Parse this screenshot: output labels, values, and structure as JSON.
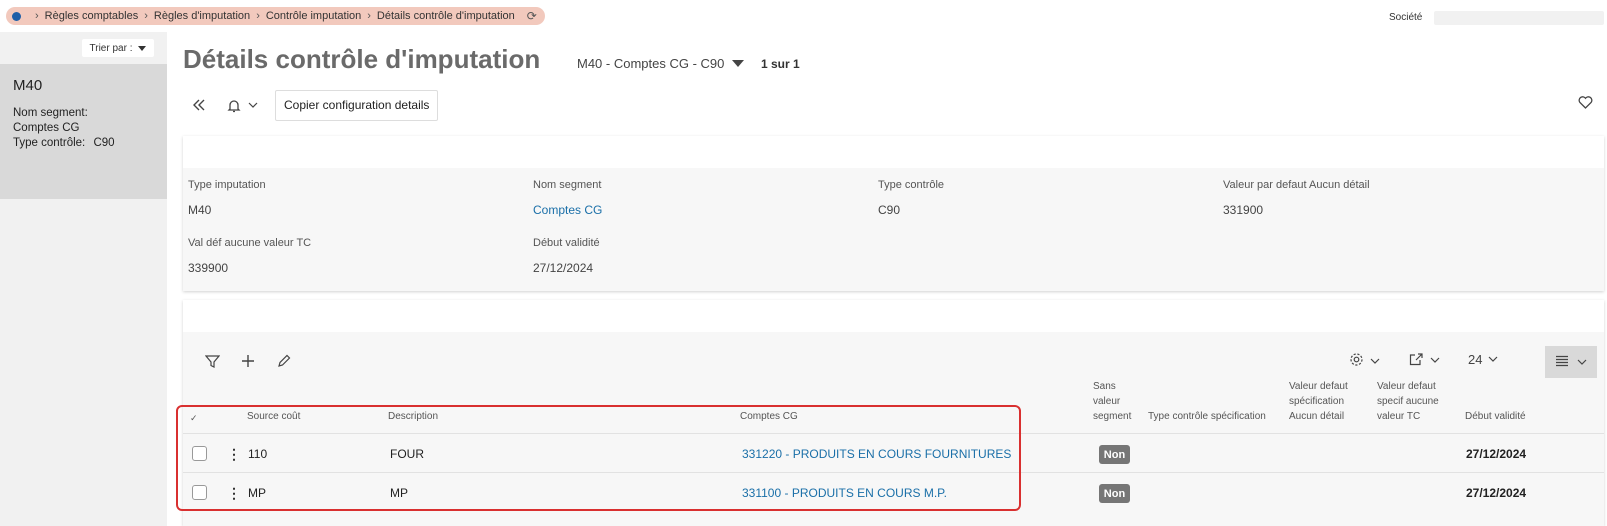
{
  "breadcrumb": [
    "Règles comptables",
    "Règles d'imputation",
    "Contrôle imputation",
    "Détails contrôle d'imputation"
  ],
  "societe_label": "Société",
  "sidebar": {
    "sort_label": "Trier par :",
    "card": {
      "title": "M40",
      "line1": "Nom segment:",
      "line2": "Comptes CG",
      "line3_label": "Type contrôle:",
      "line3_value": "C90"
    }
  },
  "header": {
    "title": "Détails contrôle d'imputation",
    "selector": "M40 - Comptes CG - C90",
    "pager": "1 sur 1"
  },
  "toolbar": {
    "copy_label": "Copier configuration details"
  },
  "details": {
    "type_imputation_label": "Type imputation",
    "type_imputation_value": "M40",
    "nom_segment_label": "Nom segment",
    "nom_segment_value": "Comptes CG",
    "type_controle_label": "Type contrôle",
    "type_controle_value": "C90",
    "valeur_defaut_label": "Valeur par defaut Aucun détail",
    "valeur_defaut_value": "331900",
    "val_def_tc_label": "Val déf aucune valeur TC",
    "val_def_tc_value": "339900",
    "debut_validite_label": "Début validité",
    "debut_validite_value": "27/12/2024"
  },
  "grid": {
    "page_size": "24",
    "columns": {
      "source_cout": "Source coût",
      "description": "Description",
      "comptes_cg": "Comptes CG",
      "sans_valeur_1": "Sans",
      "sans_valeur_2": "valeur",
      "sans_valeur_3": "segment",
      "type_controle_spec": "Type contrôle spécification",
      "valeur_spec_1": "Valeur defaut",
      "valeur_spec_2": "spécification",
      "valeur_spec_3": "Aucun détail",
      "valeur_tc_1": "Valeur defaut",
      "valeur_tc_2": "specif aucune",
      "valeur_tc_3": "valeur TC",
      "debut_validite": "Début validité"
    },
    "rows": [
      {
        "source": "110",
        "description": "FOUR",
        "compte": "331220 - PRODUITS EN COURS FOURNITURES",
        "sans_valeur": "Non",
        "debut": "27/12/2024"
      },
      {
        "source": "MP",
        "description": "MP",
        "compte": "331100 - PRODUITS EN COURS M.P.",
        "sans_valeur": "Non",
        "debut": "27/12/2024"
      }
    ]
  },
  "colors": {
    "breadcrumb_bg": "#f2c9bd",
    "link": "#1a6fa8",
    "highlight": "#d93030",
    "badge": "#767676"
  }
}
